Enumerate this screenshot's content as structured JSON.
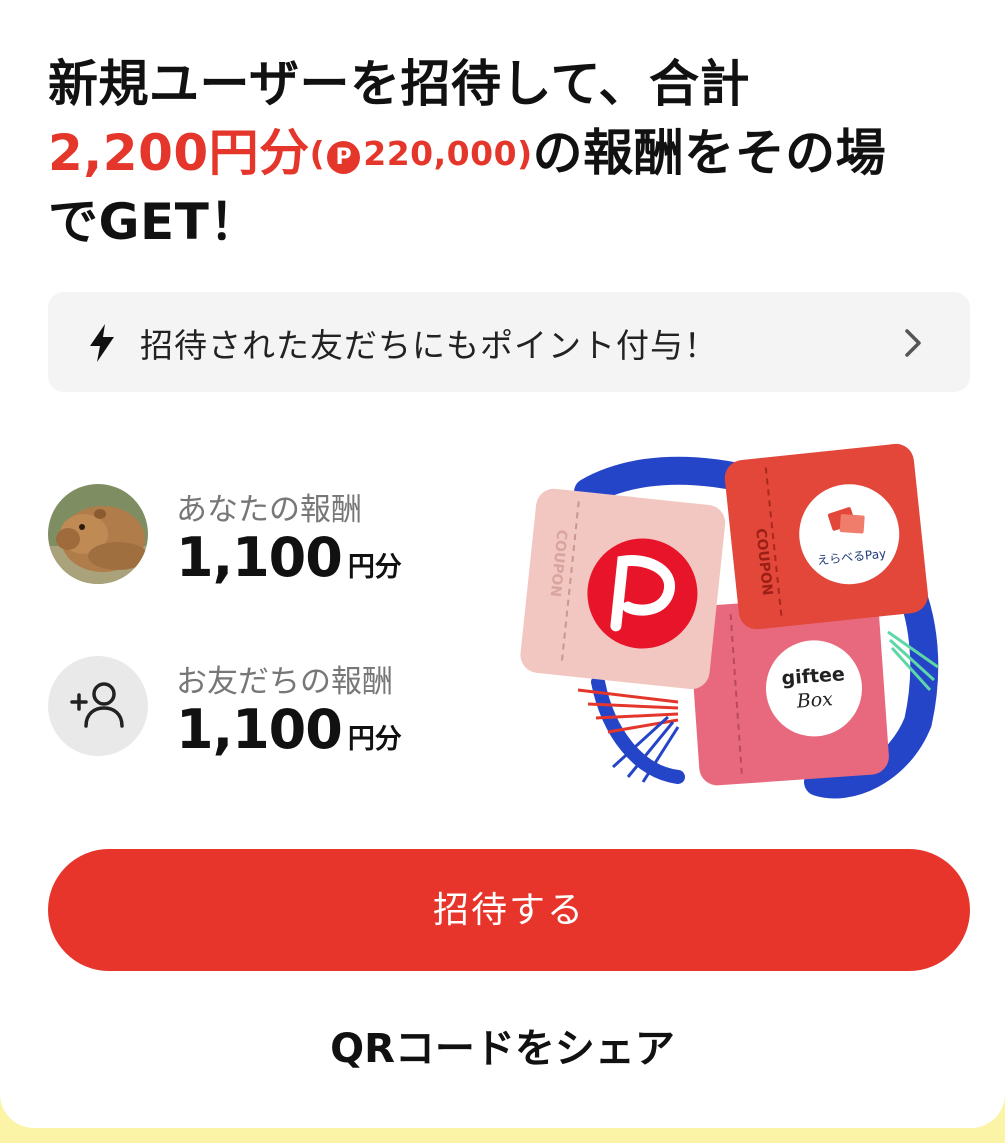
{
  "headline": {
    "line1": "新規ユーザーを招待して、合計",
    "amount": "2,200円分",
    "points_open": "(",
    "points_icon": "P",
    "points": "220,000",
    "points_close": ")",
    "line2_rest": "の報酬をその場",
    "line3": "でGET！"
  },
  "notice": {
    "icon": "lightning-bolt-icon",
    "text": "招待された友だちにもポイント付与！",
    "chevron_icon": "chevron-right-icon"
  },
  "rewards": [
    {
      "label": "あなたの報酬",
      "value": "1,100",
      "unit": "円分",
      "avatar": "capybara-avatar"
    },
    {
      "label": "お友だちの報酬",
      "value": "1,100",
      "unit": "円分",
      "avatar": "add-friend-icon"
    }
  ],
  "coupons": {
    "coupon_text": "COUPON",
    "erabel_pay": "えらべるPay",
    "giftee_line1": "giftee",
    "giftee_line2": "Box"
  },
  "actions": {
    "invite": "招待する",
    "qr_share": "QRコードをシェア"
  },
  "colors": {
    "accent_red": "#e5362b",
    "background_yellow": "#fbf3a6",
    "notice_bg": "#f4f4f4"
  }
}
